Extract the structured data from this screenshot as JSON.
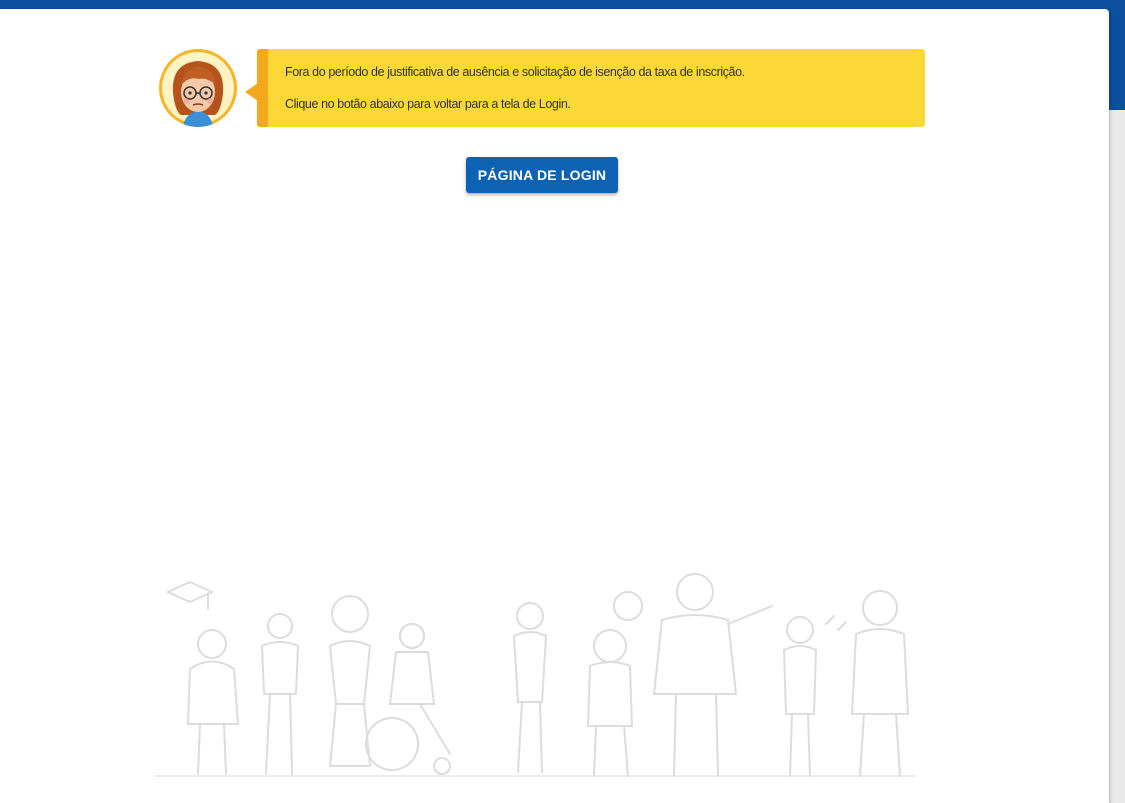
{
  "message": {
    "line1": "Fora do período de justificativa de ausência e solicitação de isenção da taxa de inscrição.",
    "line2": "Clique no botão abaixo para voltar para a tela de Login."
  },
  "login_button": {
    "label": "PÁGINA DE LOGIN"
  },
  "colors": {
    "header": "#0c4f9e",
    "alert_background": "#fbd835",
    "alert_border": "#f4a91d",
    "button": "#0e62b4"
  },
  "icons": {
    "avatar": "assistant-avatar-icon",
    "illustration": "people-illustration"
  }
}
